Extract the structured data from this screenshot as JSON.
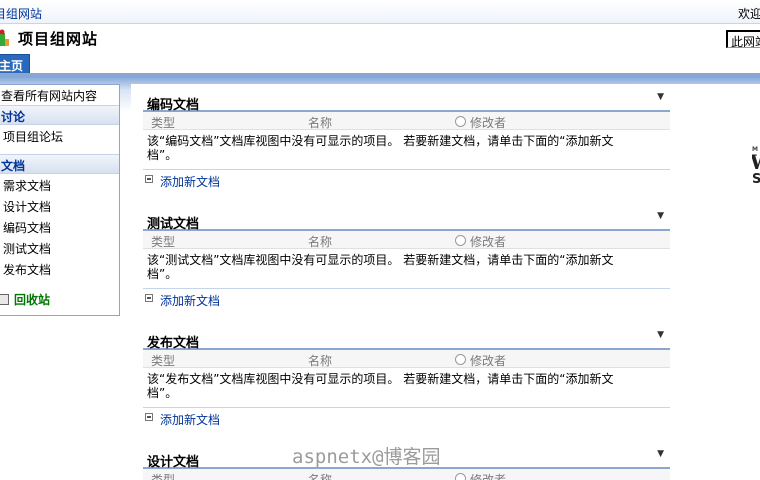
{
  "topbar": {
    "site_link": "目组网站",
    "welcome": "欢迎"
  },
  "header": {
    "site_title": "项目组网站",
    "search_value": "此网站"
  },
  "tabs": {
    "home": "主页"
  },
  "leftnav": {
    "view_all": "查看所有网站内容",
    "discussions_header": "讨论",
    "discussion_items": [
      "项目组论坛"
    ],
    "documents_header": "文档",
    "document_items": [
      "需求文档",
      "设计文档",
      "编码文档",
      "测试文档",
      "发布文档"
    ],
    "recycle_bin": "回收站"
  },
  "columns": {
    "type": "类型",
    "name": "名称",
    "modified_by": "修改者"
  },
  "webparts": [
    {
      "title": "编码文档",
      "empty_message": "该“编码文档”文档库视图中没有可显示的项目。 若要新建文档，请单击下面的“添加新文档”。",
      "add_link": "添加新文档"
    },
    {
      "title": "测试文档",
      "empty_message": "该“测试文档”文档库视图中没有可显示的项目。 若要新建文档，请单击下面的“添加新文档”。",
      "add_link": "添加新文档"
    },
    {
      "title": "发布文档",
      "empty_message": "该“发布文档”文档库视图中没有可显示的项目。 若要新建文档，请单击下面的“添加新文档”。",
      "add_link": "添加新文档"
    },
    {
      "title": "设计文档",
      "empty_message": "",
      "add_link": ""
    }
  ],
  "watermark": "aspnetx@博客园",
  "colors": {
    "accent": "#2a6abd",
    "nav_header": "#003399",
    "recycle": "#007700",
    "border": "#8ba6cf"
  }
}
